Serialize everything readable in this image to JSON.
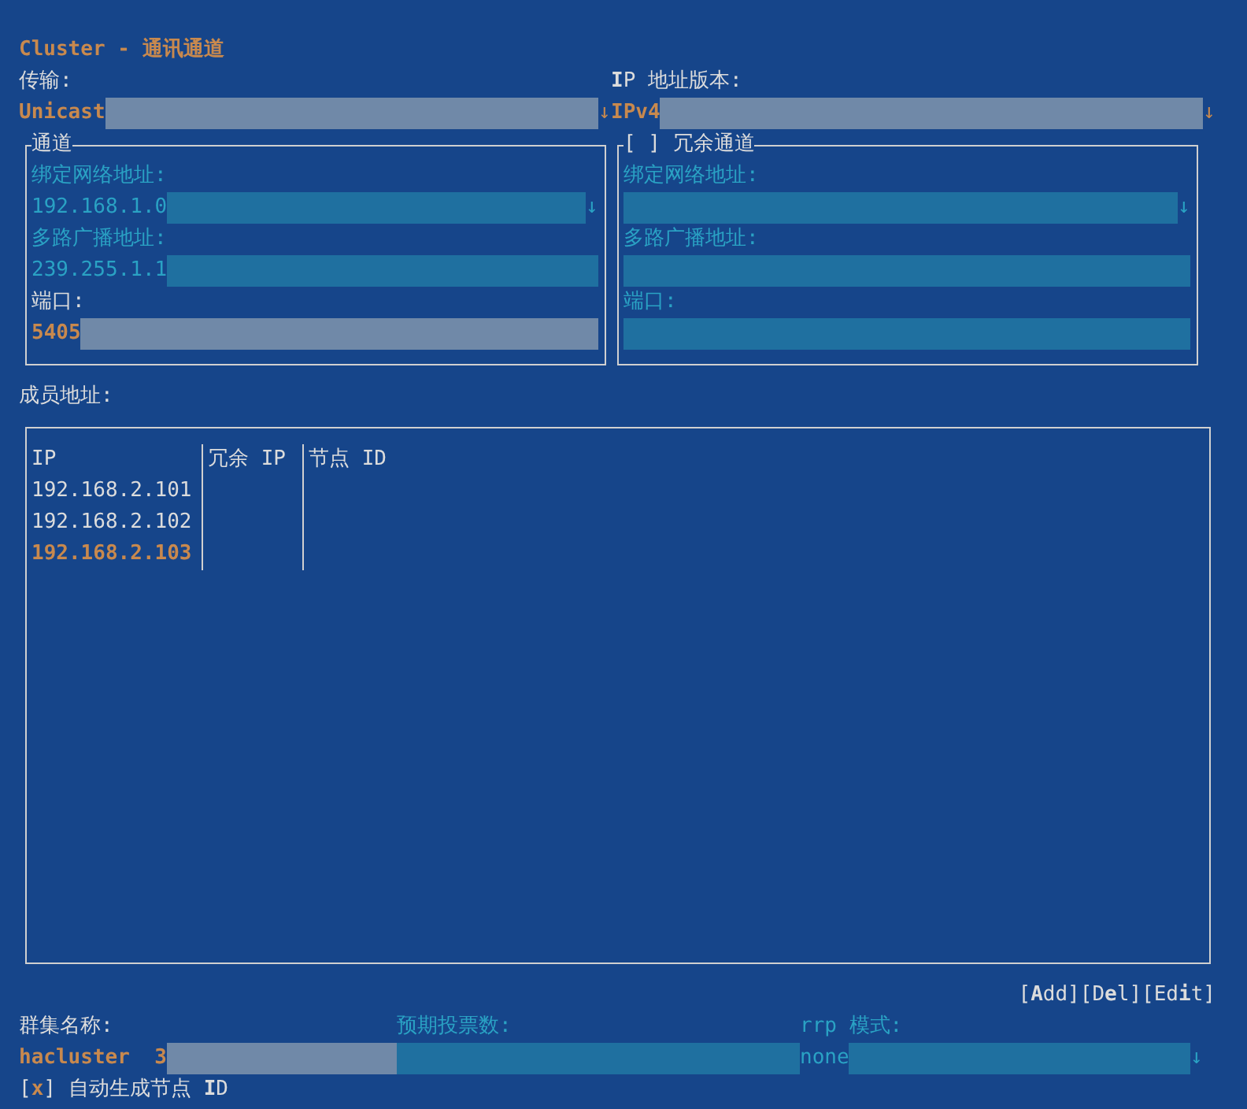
{
  "title": "Cluster - 通讯通道",
  "transport": {
    "label": "传输:",
    "value": "Unicast",
    "arrow": "↓",
    "disabled": false
  },
  "ip_version": {
    "label": "**I**P 地址版本:",
    "value": "IPv4",
    "arrow": "↓",
    "disabled": false
  },
  "channel": {
    "title": "通道",
    "fields": [
      {
        "label": "绑定网络地址:",
        "value": "192.168.1.0",
        "arrow": "↓",
        "disabled": true
      },
      {
        "label": "多路广播地址:",
        "value": "239.255.1.1",
        "disabled": true
      },
      {
        "label": "端口:",
        "value": "5405",
        "disabled": false
      }
    ]
  },
  "redundant_channel": {
    "box_left": "[",
    "box_right": "]",
    "checked": false,
    "title": "冗余通道",
    "fields": [
      {
        "label": "绑定网络地址:",
        "arrow": "↓",
        "disabled": true
      },
      {
        "label": "多路广播地址:",
        "disabled": true
      },
      {
        "label": "端口:",
        "disabled": true
      }
    ]
  },
  "members": {
    "label": "成员地址:",
    "columns": [
      "IP",
      "冗余 IP",
      "节点 ID"
    ],
    "rows": [
      {
        "ip": "192.168.2.101",
        "selected": false
      },
      {
        "ip": "192.168.2.102",
        "selected": false
      },
      {
        "ip": "192.168.2.103",
        "selected": true
      }
    ]
  },
  "buttons": [
    "[**A**dd]",
    "[D**e**l]",
    "[Ed**i**t]"
  ],
  "cluster_name": {
    "label": "群集名称:",
    "value": "hacluster  3",
    "disabled": false
  },
  "expected_votes": {
    "label": "预期投票数:",
    "disabled": true
  },
  "rrp_mode": {
    "label": "rrp 模式:",
    "value": "none",
    "arrow": "↓",
    "disabled": true
  },
  "auto_node_id": {
    "box_left": "[",
    "box_right": "]",
    "checked": true,
    "check_glyph": "x",
    "label": "自动生成节点 **I**D"
  }
}
